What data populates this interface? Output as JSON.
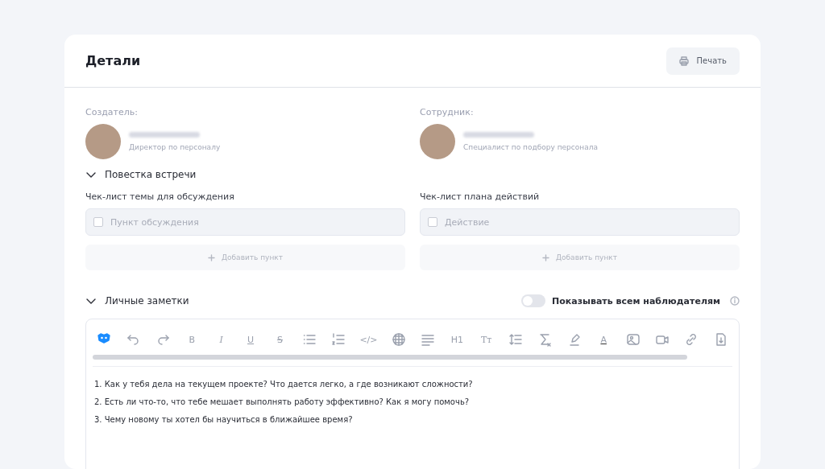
{
  "header": {
    "title": "Детали",
    "print_button": "Печать"
  },
  "people": [
    {
      "role": "Создатель:",
      "position": "Директор по персоналу"
    },
    {
      "role": "Сотрудник:",
      "position": "Специалист по подбору персонала"
    }
  ],
  "agenda": {
    "title": "Повестка встречи",
    "expanded": true,
    "checklists": [
      {
        "title": "Чек-лист темы для обсуждения",
        "items": [
          {
            "placeholder": "Пункт обсуждения",
            "checked": false
          }
        ],
        "add_button": "Добавить пункт"
      },
      {
        "title": "Чек-лист плана действий",
        "items": [
          {
            "placeholder": "Действие",
            "checked": false
          }
        ],
        "add_button": "Добавить пункт"
      }
    ]
  },
  "notes": {
    "title": "Личные заметки",
    "expanded": true,
    "share_toggle": {
      "label": "Показывать всем наблюдателям",
      "on": false
    },
    "toolbar": [
      {
        "kind": "icon"
      },
      {
        "kind": "icon"
      },
      {
        "kind": "icon"
      },
      {
        "kind": "glyph",
        "text": "B"
      },
      {
        "kind": "glyph",
        "text": "I"
      },
      {
        "kind": "glyph",
        "text": "U"
      },
      {
        "kind": "glyph",
        "text": "S"
      },
      {
        "kind": "icon"
      },
      {
        "kind": "icon"
      },
      {
        "kind": "glyph",
        "text": "</>"
      },
      {
        "kind": "icon"
      },
      {
        "kind": "icon"
      },
      {
        "kind": "glyph",
        "text": "H1"
      },
      {
        "kind": "glyph",
        "text": "Tт"
      },
      {
        "kind": "icon"
      },
      {
        "kind": "icon"
      },
      {
        "kind": "icon"
      },
      {
        "kind": "glyph",
        "text": "A"
      },
      {
        "kind": "icon"
      },
      {
        "kind": "icon"
      },
      {
        "kind": "icon"
      },
      {
        "kind": "icon"
      }
    ],
    "lines": [
      "1. Как у тебя дела на текущем проекте? Что дается легко, а где возникают сложности?",
      "2. Есть ли что-то, что тебе мешает выполнять работу эффективно? Как я могу помочь?",
      "3. Чему новому ты хотел бы научиться в ближайшее время?"
    ]
  }
}
